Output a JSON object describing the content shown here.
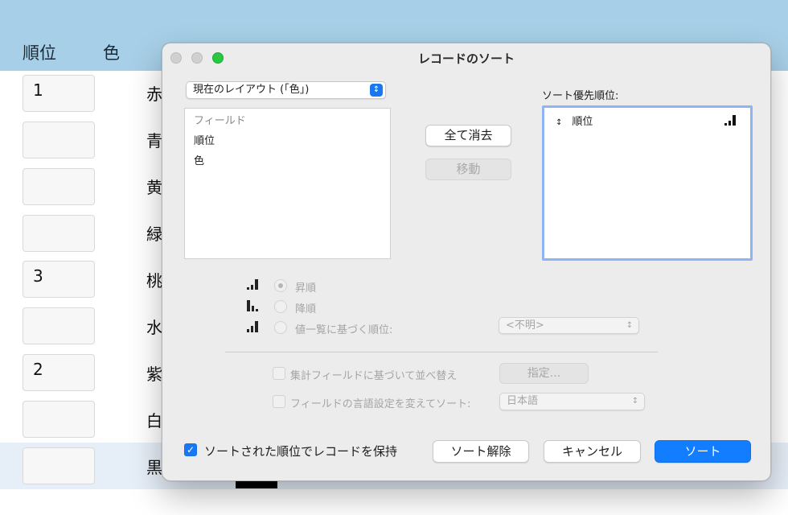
{
  "background": {
    "columns": {
      "rank": "順位",
      "color": "色"
    },
    "rank_cells": [
      "1",
      "",
      "",
      "",
      "3",
      "",
      "2",
      "",
      ""
    ],
    "color_cells": [
      "赤",
      "青",
      "黄",
      "緑",
      "桃",
      "水",
      "紫",
      "白",
      "黒"
    ]
  },
  "dialog": {
    "title": "レコードのソート",
    "layout_popup": "現在のレイアウト (「色」)",
    "fields_header": "フィールド",
    "fields": [
      "順位",
      "色"
    ],
    "clear_all_button": "全て消去",
    "move_button": "移動",
    "sort_priority_label": "ソート優先順位:",
    "sort_items": [
      {
        "name": "順位"
      }
    ],
    "order": {
      "ascending": "昇順",
      "descending": "降順",
      "value_list": "値一覧に基づく順位:",
      "value_list_popup": "<不明>"
    },
    "summary_checkbox": "集計フィールドに基づいて並べ替え",
    "specify_button": "指定...",
    "language_checkbox": "フィールドの言語設定を変えてソート:",
    "language_popup": "日本語",
    "keep_sorted_checkbox": "ソートされた順位でレコードを保持",
    "keep_sorted_checked": true,
    "unsort_button": "ソート解除",
    "cancel_button": "キャンセル",
    "sort_button": "ソート"
  },
  "colors": {
    "accent": "#127dff",
    "header_bg": "#a7cfe7",
    "highlight_row": "#e6eef8"
  }
}
